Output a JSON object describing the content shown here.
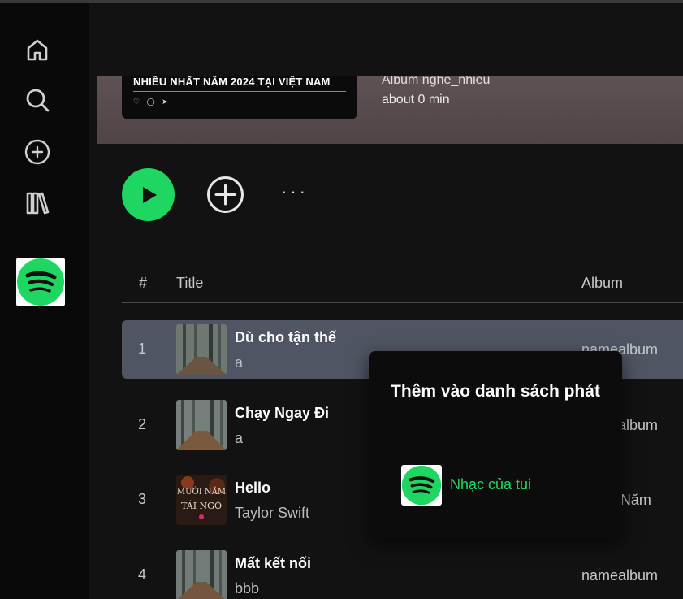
{
  "hero": {
    "cover_title": "NHIỀU NHẤT NĂM 2024 TẠI VIỆT NAM",
    "subtitle": "Album nghe_nhieu",
    "duration": "about 0 min"
  },
  "icons": {
    "home": "home-icon",
    "search": "search-icon",
    "create": "plus-circle-icon",
    "library": "library-icon",
    "play": "play-icon",
    "add": "add-circle-icon",
    "more": "more-icon"
  },
  "controls": {
    "more_label": "···"
  },
  "table": {
    "headers": {
      "num": "#",
      "title": "Title",
      "album": "Album"
    },
    "rows": [
      {
        "num": "1",
        "title": "Dù cho tận thế",
        "artist": "a",
        "album": "namealbum"
      },
      {
        "num": "2",
        "title": "Chạy Ngay Đi",
        "artist": "a",
        "album": "namealbum"
      },
      {
        "num": "3",
        "title": "Hello",
        "artist": "Taylor Swift",
        "album": "Mười Năm"
      },
      {
        "num": "4",
        "title": "Mất kết nối",
        "artist": "bbb",
        "album": "namealbum"
      }
    ]
  },
  "popup": {
    "title": "Thêm vào danh sách phát",
    "item_label": "Nhạc của tui"
  },
  "colors": {
    "accent": "#1ed760",
    "background": "#121212",
    "sidebar": "#090909",
    "active_row": "#4f5563"
  }
}
